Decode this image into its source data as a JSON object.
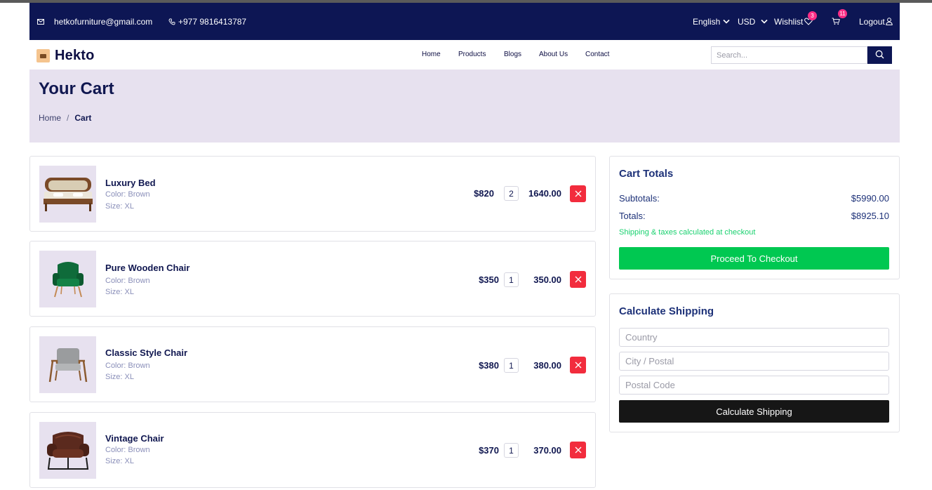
{
  "topbar": {
    "email": "hetkofurniture@gmail.com",
    "phone": "+977 9816413787",
    "language": "English",
    "currency": "USD",
    "wishlist_label": "Wishlist",
    "wishlist_count": "3",
    "cart_count": "11",
    "logout_label": "Logout"
  },
  "header": {
    "brand": "Hekto",
    "nav": [
      "Home",
      "Products",
      "Blogs",
      "About Us",
      "Contact"
    ],
    "search_placeholder": "Search..."
  },
  "hero": {
    "title": "Your Cart",
    "breadcrumb": [
      "Home",
      "Cart"
    ]
  },
  "cart": {
    "items": [
      {
        "name": "Luxury Bed",
        "color": "Color: Brown",
        "size": "Size: XL",
        "price": "$820",
        "qty": "2",
        "subtotal": "1640.00",
        "icon": "bed-icon"
      },
      {
        "name": "Pure Wooden Chair",
        "color": "Color: Brown",
        "size": "Size: XL",
        "price": "$350",
        "qty": "1",
        "subtotal": "350.00",
        "icon": "green-armchair-icon"
      },
      {
        "name": "Classic Style Chair",
        "color": "Color: Brown",
        "size": "Size: XL",
        "price": "$380",
        "qty": "1",
        "subtotal": "380.00",
        "icon": "grey-armchair-icon"
      },
      {
        "name": "Vintage Chair",
        "color": "Color: Brown",
        "size": "Size: XL",
        "price": "$370",
        "qty": "1",
        "subtotal": "370.00",
        "icon": "leather-chair-icon"
      }
    ]
  },
  "totals": {
    "title": "Cart Totals",
    "subtotal_label": "Subtotals:",
    "subtotal_value": "$5990.00",
    "total_label": "Totals:",
    "total_value": "$8925.10",
    "note": "Shipping & taxes calculated at checkout",
    "checkout_label": "Proceed To Checkout"
  },
  "shipping": {
    "title": "Calculate Shipping",
    "country_placeholder": "Country",
    "city_placeholder": "City / Postal",
    "postal_placeholder": "Postal Code",
    "button_label": "Calculate Shipping"
  },
  "colors": {
    "navy": "#0d1654",
    "hero_bg": "#e7e1ef",
    "remove_red": "#f22c3d",
    "checkout_green": "#00c851",
    "badge_pink": "#fb2e86"
  }
}
